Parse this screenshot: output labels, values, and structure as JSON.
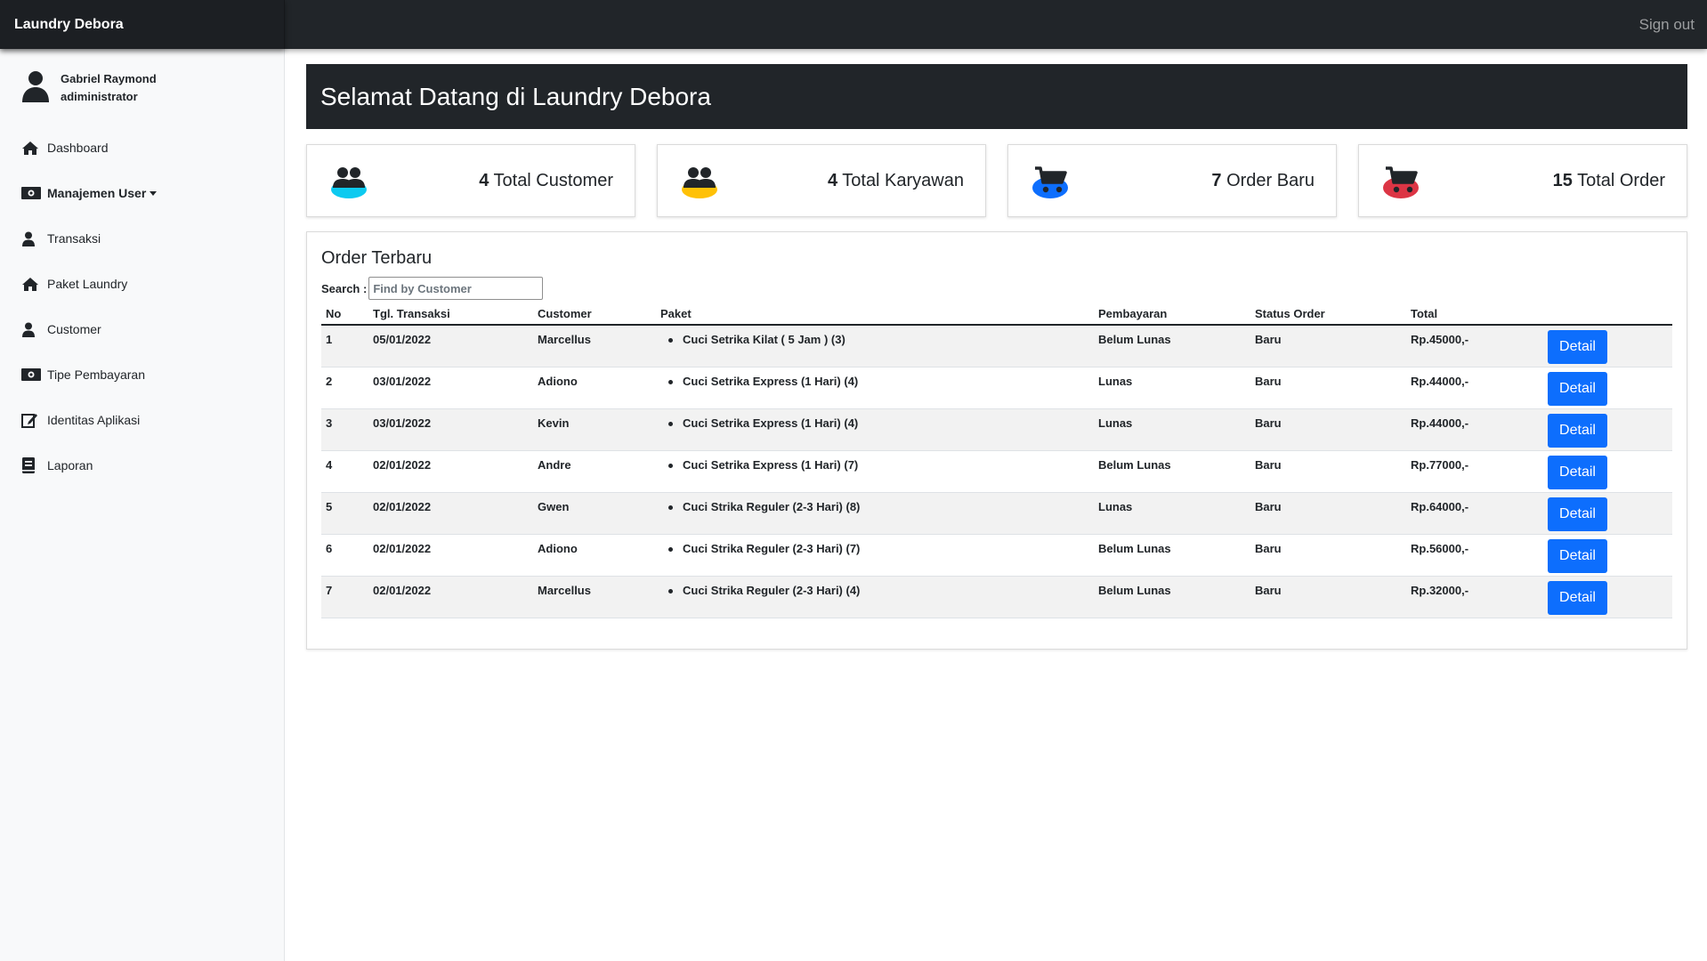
{
  "app": {
    "brand": "Laundry Debora",
    "signout_label": "Sign out"
  },
  "sidebar": {
    "user_name": "Gabriel Raymond",
    "user_role": "adiministrator",
    "items": [
      {
        "label": "Dashboard",
        "icon": "home-icon"
      },
      {
        "label": "Manajemen User",
        "icon": "money-icon"
      },
      {
        "label": "Transaksi",
        "icon": "user-icon"
      },
      {
        "label": "Paket Laundry",
        "icon": "home-icon"
      },
      {
        "label": "Customer",
        "icon": "user-icon"
      },
      {
        "label": "Tipe Pembayaran",
        "icon": "money-icon"
      },
      {
        "label": "Identitas Aplikasi",
        "icon": "edit-icon"
      },
      {
        "label": "Laporan",
        "icon": "book-icon"
      }
    ]
  },
  "welcome": {
    "title": "Selamat Datang di Laundry Debora"
  },
  "stats": [
    {
      "count": "4",
      "label": " Total Customer",
      "icon": "users-icon",
      "icon_color": "#0dcaf0"
    },
    {
      "count": "4",
      "label": " Total Karyawan",
      "icon": "users-icon",
      "icon_color": "#ffc107"
    },
    {
      "count": "7",
      "label": " Order Baru",
      "icon": "cart-icon",
      "icon_color": "#0d6efd"
    },
    {
      "count": "15",
      "label": " Total Order",
      "icon": "cart-icon",
      "icon_color": "#dc3545"
    }
  ],
  "orders": {
    "title": "Order Terbaru",
    "search_label": "Search :",
    "search_placeholder": "Find by Customer",
    "columns": [
      "No",
      "Tgl. Transaksi",
      "Customer",
      "Paket",
      "Pembayaran",
      "Status Order",
      "Total",
      ""
    ],
    "detail_label": "Detail",
    "rows": [
      {
        "no": "1",
        "tgl": "05/01/2022",
        "customer": "Marcellus",
        "paket": "Cuci Setrika Kilat ( 5 Jam ) (3)",
        "pembayaran": "Belum Lunas",
        "status": "Baru",
        "total": "Rp.45000,-"
      },
      {
        "no": "2",
        "tgl": "03/01/2022",
        "customer": "Adiono",
        "paket": "Cuci Setrika Express (1 Hari) (4)",
        "pembayaran": "Lunas",
        "status": "Baru",
        "total": "Rp.44000,-"
      },
      {
        "no": "3",
        "tgl": "03/01/2022",
        "customer": "Kevin",
        "paket": "Cuci Setrika Express (1 Hari) (4)",
        "pembayaran": "Lunas",
        "status": "Baru",
        "total": "Rp.44000,-"
      },
      {
        "no": "4",
        "tgl": "02/01/2022",
        "customer": "Andre",
        "paket": "Cuci Setrika Express (1 Hari) (7)",
        "pembayaran": "Belum Lunas",
        "status": "Baru",
        "total": "Rp.77000,-"
      },
      {
        "no": "5",
        "tgl": "02/01/2022",
        "customer": "Gwen",
        "paket": "Cuci Strika Reguler (2-3 Hari) (8)",
        "pembayaran": "Lunas",
        "status": "Baru",
        "total": "Rp.64000,-"
      },
      {
        "no": "6",
        "tgl": "02/01/2022",
        "customer": "Adiono",
        "paket": "Cuci Strika Reguler (2-3 Hari) (7)",
        "pembayaran": "Belum Lunas",
        "status": "Baru",
        "total": "Rp.56000,-"
      },
      {
        "no": "7",
        "tgl": "02/01/2022",
        "customer": "Marcellus",
        "paket": "Cuci Strika Reguler (2-3 Hari) (4)",
        "pembayaran": "Belum Lunas",
        "status": "Baru",
        "total": "Rp.32000,-"
      }
    ]
  }
}
